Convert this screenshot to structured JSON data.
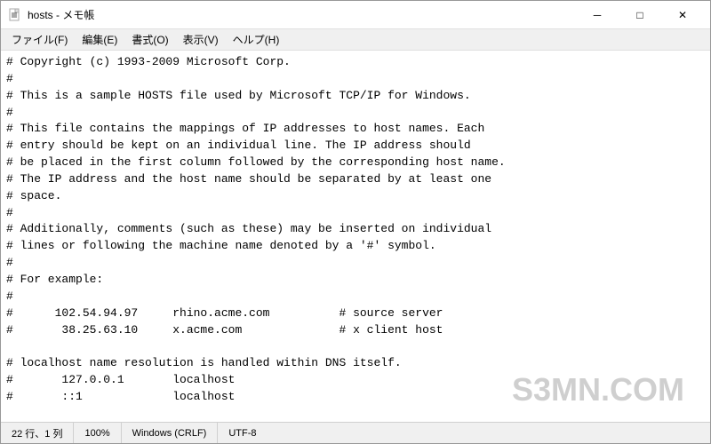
{
  "titleBar": {
    "title": "hosts - メモ帳",
    "icon": "📄",
    "minimizeLabel": "─",
    "maximizeLabel": "□",
    "closeLabel": "✕"
  },
  "menuBar": {
    "items": [
      {
        "label": "ファイル(F)"
      },
      {
        "label": "編集(E)"
      },
      {
        "label": "書式(O)"
      },
      {
        "label": "表示(V)"
      },
      {
        "label": "ヘルプ(H)"
      }
    ]
  },
  "editor": {
    "content": "# Copyright (c) 1993-2009 Microsoft Corp.\n#\n# This is a sample HOSTS file used by Microsoft TCP/IP for Windows.\n#\n# This file contains the mappings of IP addresses to host names. Each\n# entry should be kept on an individual line. The IP address should\n# be placed in the first column followed by the corresponding host name.\n# The IP address and the host name should be separated by at least one\n# space.\n#\n# Additionally, comments (such as these) may be inserted on individual\n# lines or following the machine name denoted by a '#' symbol.\n#\n# For example:\n#\n#      102.54.94.97     rhino.acme.com          # source server\n#       38.25.63.10     x.acme.com              # x client host\n\n# localhost name resolution is handled within DNS itself.\n#\t127.0.0.1       localhost\n#\t::1             localhost\n"
  },
  "statusBar": {
    "position": "22 行、1 列",
    "zoom": "100%",
    "lineEnding": "Windows (CRLF)",
    "encoding": "UTF-8"
  },
  "watermark": "S3MN.COM"
}
